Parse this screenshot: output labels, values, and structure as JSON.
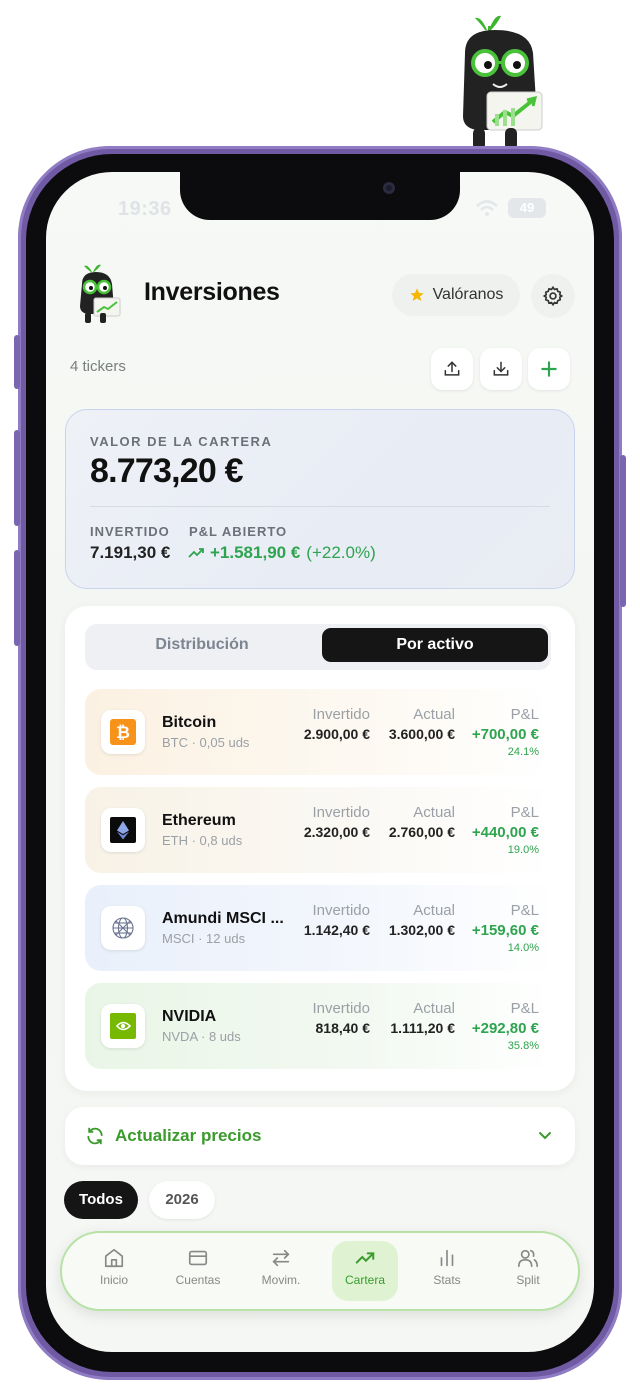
{
  "status": {
    "time": "19:36",
    "battery": "49"
  },
  "header": {
    "title": "Inversiones",
    "rate_label": "Valóranos",
    "tickers_count": "4 tickers"
  },
  "portfolio": {
    "value_label": "VALOR DE LA CARTERA",
    "value": "8.773,20 €",
    "invested_label": "INVERTIDO",
    "invested": "7.191,30 €",
    "pl_label": "P&L ABIERTO",
    "pl_value": "+1.581,90 €",
    "pl_pct": "(+22.0%)"
  },
  "tabs": {
    "distribution": "Distribución",
    "by_asset": "Por activo",
    "active": "by_asset"
  },
  "columns": {
    "invested": "Invertido",
    "actual": "Actual",
    "pl": "P&L"
  },
  "assets": [
    {
      "name": "Bitcoin",
      "sub": "BTC · 0,05 uds",
      "invested": "2.900,00 €",
      "actual": "3.600,00 €",
      "pl": "+700,00 €",
      "pct": "24.1%",
      "icon": "bitcoin-icon",
      "tint": "#fbf3e6"
    },
    {
      "name": "Ethereum",
      "sub": "ETH · 0,8 uds",
      "invested": "2.320,00 €",
      "actual": "2.760,00 €",
      "pl": "+440,00 €",
      "pct": "19.0%",
      "icon": "ethereum-icon",
      "tint": "#f8f4ec"
    },
    {
      "name": "Amundi MSCI ...",
      "sub": "MSCI · 12 uds",
      "invested": "1.142,40 €",
      "actual": "1.302,00 €",
      "pl": "+159,60 €",
      "pct": "14.0%",
      "icon": "globe-icon",
      "tint": "#eef3fb"
    },
    {
      "name": "NVIDIA",
      "sub": "NVDA · 8 uds",
      "invested": "818,40 €",
      "actual": "1.111,20 €",
      "pl": "+292,80 €",
      "pct": "35.8%",
      "icon": "nvidia-icon",
      "tint": "#eef8ee"
    }
  ],
  "update_prices": "Actualizar precios",
  "years": {
    "all": "Todos",
    "y2026": "2026"
  },
  "nav": [
    {
      "label": "Inicio",
      "icon": "home-icon"
    },
    {
      "label": "Cuentas",
      "icon": "card-icon"
    },
    {
      "label": "Movim.",
      "icon": "transfer-icon"
    },
    {
      "label": "Cartera",
      "icon": "trend-icon",
      "active": true
    },
    {
      "label": "Stats",
      "icon": "chart-icon"
    },
    {
      "label": "Split",
      "icon": "users-icon"
    }
  ],
  "colors": {
    "accent_green": "#2ea44f",
    "nav_green": "#3a9a2c",
    "frame_purple": "#6f5aa3",
    "dark": "#151515"
  }
}
